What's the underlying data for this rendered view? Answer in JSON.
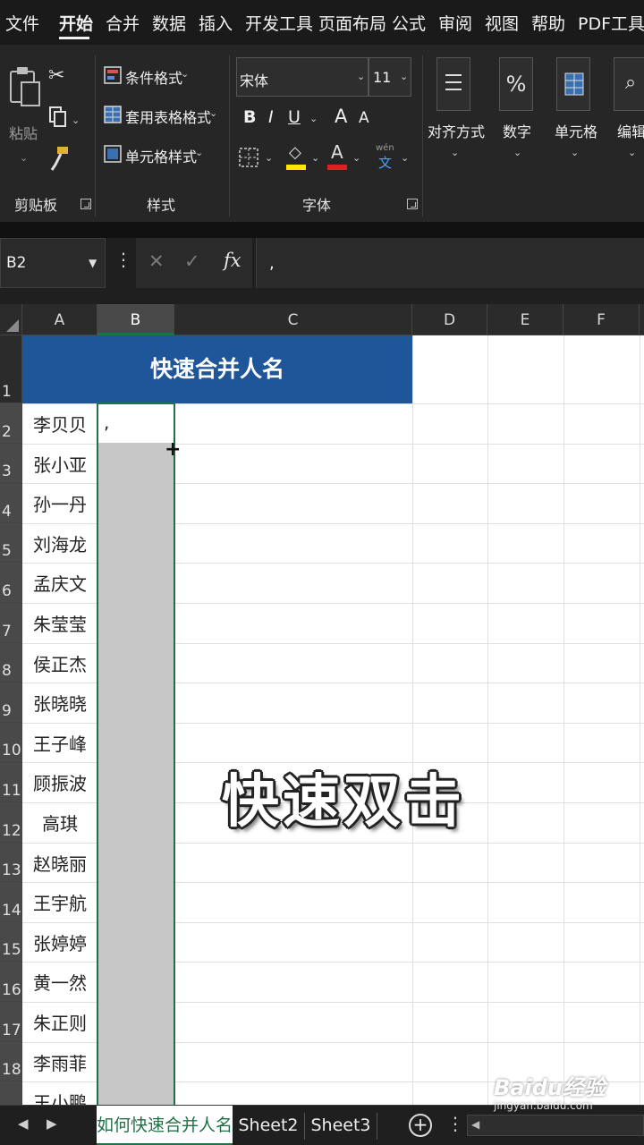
{
  "menu": {
    "tabs": [
      {
        "label": "文件"
      },
      {
        "label": "开始",
        "active": true
      },
      {
        "label": "合并"
      },
      {
        "label": "数据"
      },
      {
        "label": "插入"
      },
      {
        "label": "开发工具"
      },
      {
        "label": "页面布局"
      },
      {
        "label": "公式"
      },
      {
        "label": "审阅"
      },
      {
        "label": "视图"
      },
      {
        "label": "帮助"
      },
      {
        "label": "PDF工具集"
      }
    ]
  },
  "ribbon": {
    "clipboard": {
      "paste_label": "粘贴",
      "group_label": "剪贴板"
    },
    "styles": {
      "conditional_format": "条件格式",
      "table_format": "套用表格格式",
      "cell_styles": "单元格样式",
      "group_label": "样式"
    },
    "font": {
      "font_name": "宋体",
      "font_size": "11",
      "bold": "B",
      "italic": "I",
      "underline": "U",
      "grow": "A",
      "shrink": "A",
      "phonetic_top": "wén",
      "phonetic_bottom": "文",
      "group_label": "字体"
    },
    "alignment_label": "对齐方式",
    "number_label": "数字",
    "cells_label": "单元格",
    "editing_label": "编辑"
  },
  "formula_bar": {
    "name_box": "B2",
    "formula": ","
  },
  "grid": {
    "columns": [
      "A",
      "B",
      "C",
      "D",
      "E",
      "F"
    ],
    "selected_column": "B",
    "rows": [
      "1",
      "2",
      "3",
      "4",
      "5",
      "6",
      "7",
      "8",
      "9",
      "10",
      "11",
      "12",
      "13",
      "14",
      "15",
      "16",
      "17",
      "18"
    ],
    "header_title": "快速合并人名",
    "names": [
      "李贝贝",
      "张小亚",
      "孙一丹",
      "刘海龙",
      "孟庆文",
      "朱莹莹",
      "侯正杰",
      "张晓晓",
      "王子峰",
      "顾振波",
      "高琪",
      "赵晓丽",
      "王宇航",
      "张婷婷",
      "黄一然",
      "朱正则",
      "李雨菲",
      "王小鹏"
    ],
    "b2_value": ","
  },
  "overlay_caption": "快速双击",
  "sheet_tabs": {
    "tabs": [
      "如何快速合并人名",
      "Sheet2",
      "Sheet3"
    ],
    "active": "如何快速合并人名"
  },
  "watermark": {
    "logo": "Baidu经验",
    "url": "jingyan.baidu.com"
  },
  "colors": {
    "accent_green": "#207245",
    "header_blue": "#1f5599",
    "selection_gray": "#c7c7c7"
  }
}
